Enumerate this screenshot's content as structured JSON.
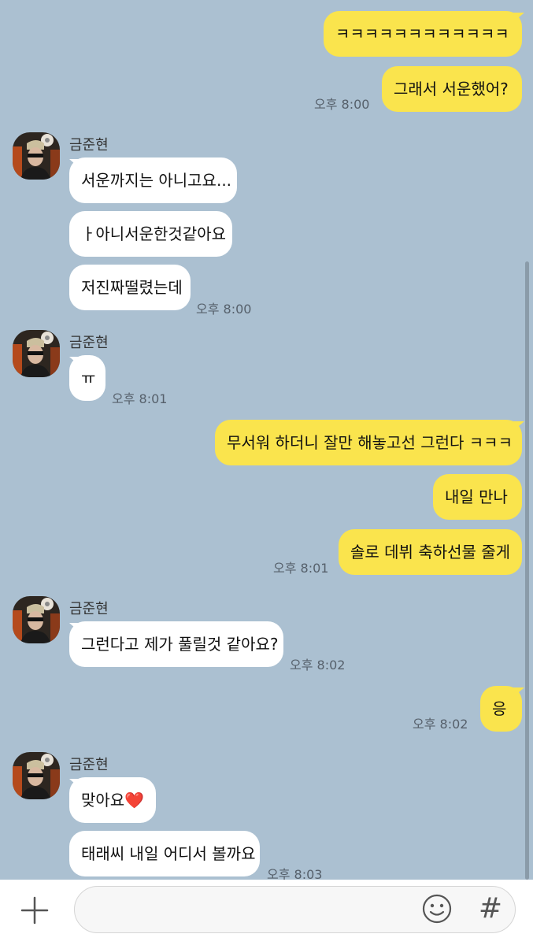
{
  "messages": {
    "m1": "ㅋㅋㅋㅋㅋㅋㅋㅋㅋㅋㅋㅋ",
    "m2": "그래서 서운했어?",
    "t1": "오후 8:00",
    "g1_name": "금준현",
    "m3": "서운까지는 아니고요...",
    "m4": "ㅏ아니서운한것같아요",
    "m5": "저진짜떨렸는데",
    "t2": "오후 8:00",
    "g2_name": "금준현",
    "m6": "ㅠ",
    "t3": "오후 8:01",
    "m7": "무서워 하더니 잘만 해놓고선 그런다 ㅋㅋㅋ",
    "m8": "내일 만나",
    "m9": "솔로 데뷔 축하선물 줄게",
    "t4": "오후 8:01",
    "g3_name": "금준현",
    "m10": "그런다고 제가 풀릴것 같아요?",
    "t5": "오후 8:02",
    "m11": "응",
    "t6": "오후 8:02",
    "g4_name": "금준현",
    "m12": "맞아요",
    "m12_emoji": "❤️",
    "m13": "태래씨 내일 어디서 볼까요",
    "t7": "오후 8:03"
  },
  "icons": {
    "add": "plus-icon",
    "emoji": "smiley-icon",
    "hashtag": "hash-icon",
    "avatar": "profile-avatar"
  },
  "input": {
    "hash_glyph": "#"
  },
  "colors": {
    "background": "#abc0d1",
    "my_bubble": "#fae44d",
    "their_bubble": "#ffffff"
  }
}
